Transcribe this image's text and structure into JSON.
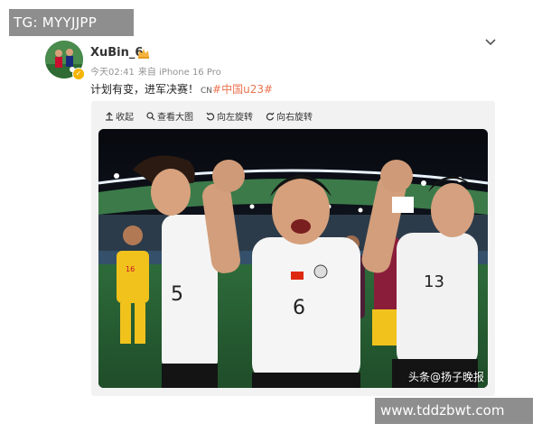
{
  "overlay": {
    "tg_label": "TG: MYYJJPP",
    "site_label": "www.tddzbwt.com"
  },
  "post": {
    "username": "XuBin_6",
    "timestamp": "今天02:41",
    "source": "来自 iPhone 16 Pro",
    "text": "计划有变，进军决赛！",
    "topic_prefix": "CN",
    "topic": "#中国u23#"
  },
  "toolbar": {
    "collapse": "收起",
    "view_large": "查看大图",
    "rotate_left": "向左旋转",
    "rotate_right": "向右旋转"
  },
  "photo": {
    "watermark": "头条@扬子晚报",
    "player_numbers": [
      "16",
      "5",
      "6",
      "13"
    ]
  },
  "colors": {
    "topic": "#eb7350",
    "meta": "#939393",
    "media_bg": "#f2f2f2",
    "badge_bg": "#8e8e8e"
  }
}
